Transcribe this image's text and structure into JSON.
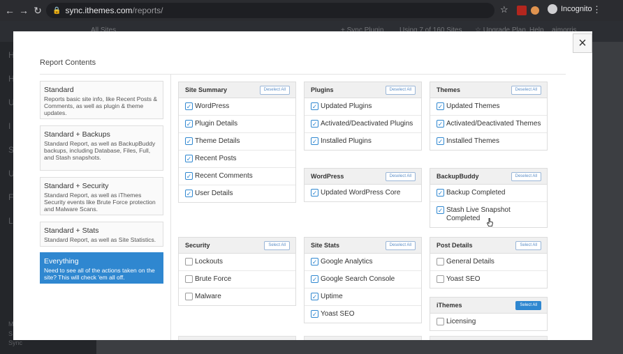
{
  "browser": {
    "url_host": "sync.ithemes.com",
    "url_path": "/reports/",
    "incognito_label": "Incognito"
  },
  "background": {
    "header_items": [
      "All Sites",
      "+ Sync Plugin",
      "Using 7 of 160 Sites",
      "☆ Upgrade Plan",
      "Help",
      "ajmorris"
    ],
    "side_letters": [
      "H",
      "H",
      "U",
      "I",
      "S",
      "U",
      "F",
      "L"
    ],
    "footer_letters": [
      "M",
      "S",
      "Sync"
    ]
  },
  "modal": {
    "close_icon": "×",
    "title": "Report Contents"
  },
  "presets": [
    {
      "title": "Standard",
      "desc": "Reports basic site info, like Recent Posts & Comments, as well as plugin & theme updates.",
      "active": false
    },
    {
      "title": "Standard + Backups",
      "desc": "Standard Report, as well as BackupBuddy backups, including Database, Files, Full, and Stash snapshots.",
      "active": false
    },
    {
      "title": "Standard + Security",
      "desc": "Standard Report, as well as iThemes Security events like Brute Force protection and Malware Scans.",
      "active": false
    },
    {
      "title": "Standard + Stats",
      "desc": "Standard Report, as well as Site Statistics.",
      "active": false
    },
    {
      "title": "Everything",
      "desc": "Need to see all of the actions taken on the site? This will check 'em all off.",
      "active": true
    }
  ],
  "groups": [
    {
      "title": "Site Summary",
      "button": "Deselect All",
      "items": [
        {
          "label": "WordPress",
          "checked": true
        },
        {
          "label": "Plugin Details",
          "checked": true
        },
        {
          "label": "Theme Details",
          "checked": true
        },
        {
          "label": "Recent Posts",
          "checked": true
        },
        {
          "label": "Recent Comments",
          "checked": true
        },
        {
          "label": "User Details",
          "checked": true
        }
      ]
    },
    {
      "title": "Plugins",
      "button": "Deselect All",
      "items": [
        {
          "label": "Updated Plugins",
          "checked": true
        },
        {
          "label": "Activated/Deactivated Plugins",
          "checked": true
        },
        {
          "label": "Installed Plugins",
          "checked": true
        }
      ]
    },
    {
      "title": "Themes",
      "button": "Deselect All",
      "items": [
        {
          "label": "Updated Themes",
          "checked": true
        },
        {
          "label": "Activated/Deactivated Themes",
          "checked": true
        },
        {
          "label": "Installed Themes",
          "checked": true
        }
      ]
    },
    {
      "title": "WordPress",
      "button": "Deselect All",
      "items": [
        {
          "label": "Updated WordPress Core",
          "checked": true
        }
      ]
    },
    {
      "title": "BackupBuddy",
      "button": "Deselect All",
      "items": [
        {
          "label": "Backup Completed",
          "checked": true
        },
        {
          "label": "Stash Live Snapshot Completed",
          "checked": true
        }
      ]
    },
    {
      "title": "Security",
      "button": "Select All",
      "items": [
        {
          "label": "Lockouts",
          "checked": false
        },
        {
          "label": "Brute Force",
          "checked": false
        },
        {
          "label": "Malware",
          "checked": false
        }
      ]
    },
    {
      "title": "Site Stats",
      "button": "Deselect All",
      "items": [
        {
          "label": "Google Analytics",
          "checked": true
        },
        {
          "label": "Google Search Console",
          "checked": true
        },
        {
          "label": "Uptime",
          "checked": true
        },
        {
          "label": "Yoast SEO",
          "checked": true
        }
      ]
    },
    {
      "title": "Post Details",
      "button": "Select All",
      "items": [
        {
          "label": "General Details",
          "checked": false
        },
        {
          "label": "Yoast SEO",
          "checked": false
        }
      ]
    },
    {
      "title": "iThemes",
      "button": "Select All",
      "button_primary": true,
      "items": [
        {
          "label": "Licensing",
          "checked": false
        }
      ]
    }
  ],
  "colors": {
    "accent": "#2f87d0",
    "checkbox_checked": "#2f87d0"
  }
}
